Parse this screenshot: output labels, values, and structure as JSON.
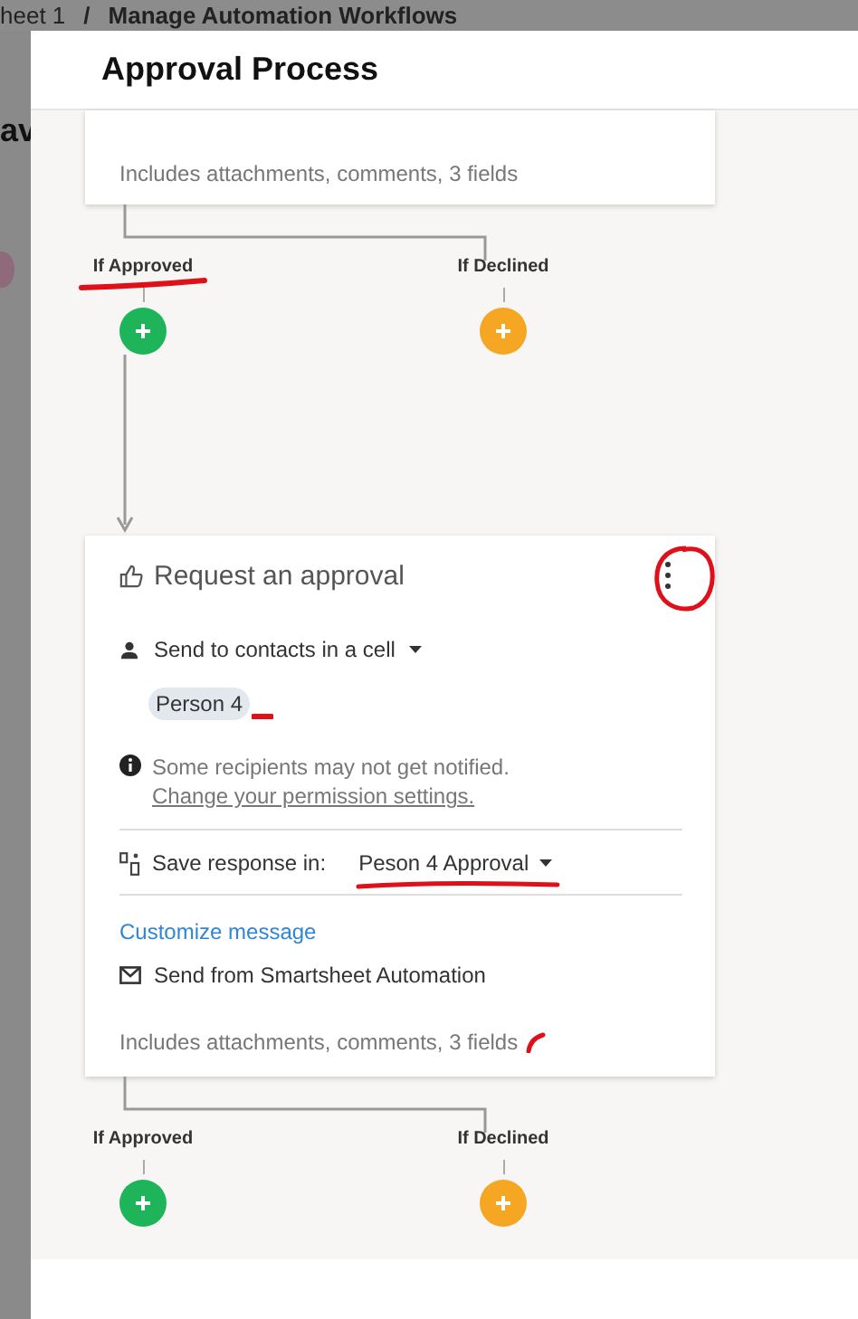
{
  "breadcrumb": {
    "items": [
      "heet 1",
      "Manage Automation Workflows"
    ],
    "separator": "/"
  },
  "background": {
    "heading_fragment": "av"
  },
  "dialog": {
    "title": "Approval Process"
  },
  "steps": [
    {
      "kind": "card_end",
      "footer": "Includes attachments, comments, 3 fields"
    },
    {
      "kind": "branch",
      "branches": [
        {
          "label": "If Approved",
          "color": "#1db45a",
          "marked": true
        },
        {
          "label": "If Declined",
          "color": "#f5a623",
          "marked": false
        }
      ]
    },
    {
      "kind": "arrow"
    },
    {
      "kind": "approval_card",
      "title": "Request an approval",
      "recipients": "Send to contacts in a cell",
      "chips": [
        "Person 4"
      ],
      "notice": "Some recipients may not get notified.",
      "notice_link": "Change your permission settings.",
      "save_label": "Save response in:",
      "save_value": "Peson 4 Approval",
      "customize": "Customize message",
      "sender": "Send from Smartsheet Automation",
      "footer": "Includes attachments, comments, 3 fields"
    },
    {
      "kind": "branch",
      "branches": [
        {
          "label": "If Approved",
          "color": "#1db45a",
          "marked": false
        },
        {
          "label": "If Declined",
          "color": "#f5a623",
          "marked": false
        }
      ]
    }
  ]
}
